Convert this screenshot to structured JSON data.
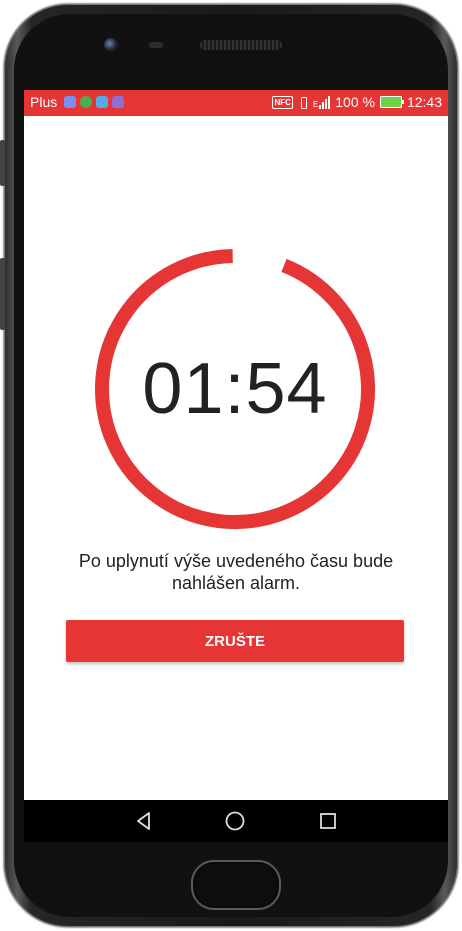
{
  "status_bar": {
    "carrier": "Plus",
    "nfc_label": "NFC",
    "signal_label": "E",
    "battery_percent": "100 %",
    "clock": "12:43",
    "notification_icons": [
      "shield-icon",
      "globe-icon",
      "image-icon",
      "calendar-icon"
    ],
    "background_color": "#e53535"
  },
  "timer": {
    "time": "01:54",
    "progress_fraction": 0.94,
    "ring_color": "#e53535"
  },
  "message": "Po uplynutí výše uvedeného času bude nahlášen alarm.",
  "cancel_button": {
    "label": "ZRUŠTE",
    "color": "#e53535"
  },
  "navigation": {
    "buttons": [
      "back-icon",
      "home-icon",
      "recents-icon"
    ]
  }
}
